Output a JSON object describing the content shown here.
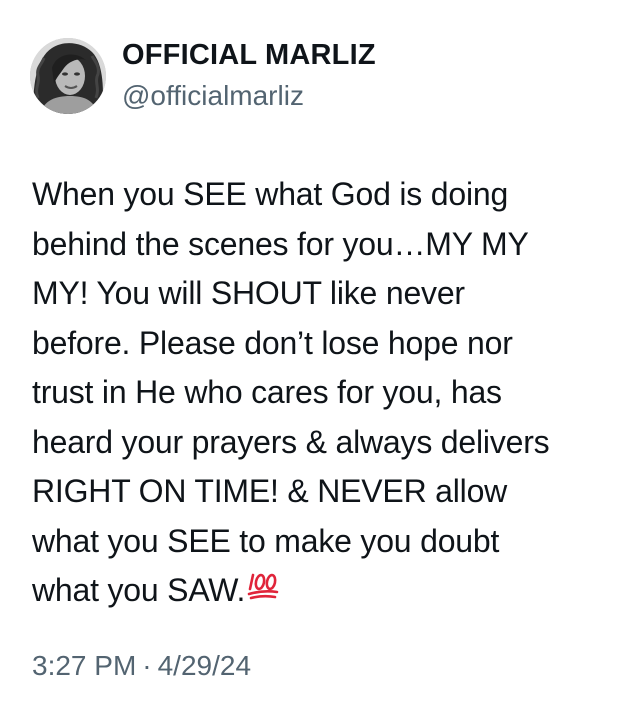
{
  "author": {
    "display_name": "OFFICIAL MARLIZ",
    "handle": "@officialmarliz",
    "avatar_icon": "profile-photo"
  },
  "tweet": {
    "lines": [
      "When you SEE what God is doing",
      "behind the scenes for you…MY MY",
      "MY! You will SHOUT like never",
      "before. Please don’t lose hope nor",
      "trust in He who cares for you, has",
      "heard your prayers & always delivers",
      "RIGHT ON TIME! & NEVER allow",
      "what you SEE to make you doubt",
      "what you SAW."
    ],
    "trailing_emoji": "hundred-points-emoji"
  },
  "meta": {
    "time": "3:27 PM",
    "separator": "·",
    "date": "4/29/24"
  },
  "colors": {
    "text": "#0f1419",
    "secondary": "#536471",
    "emoji_red": "#e0243a"
  }
}
